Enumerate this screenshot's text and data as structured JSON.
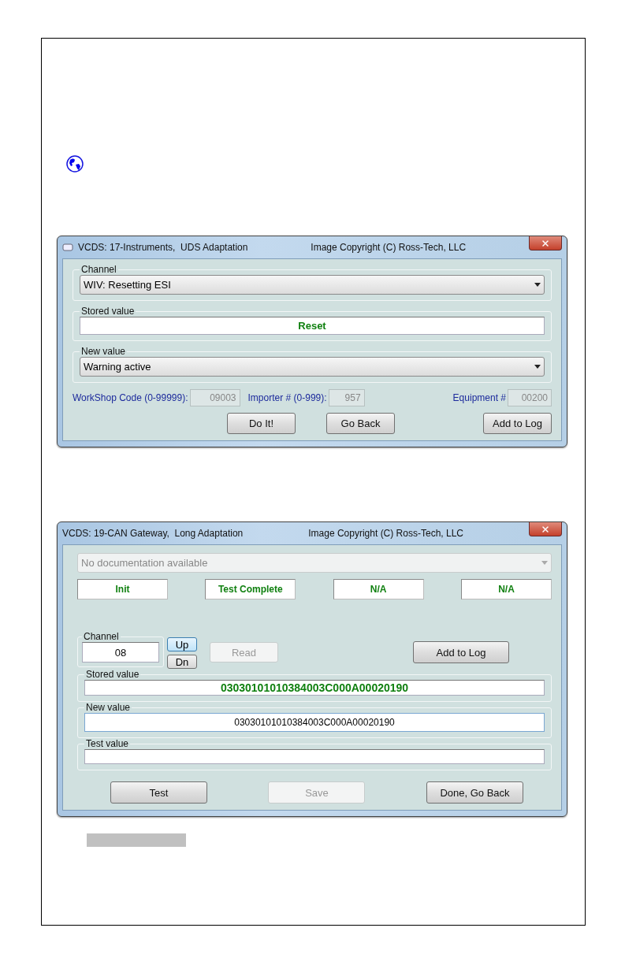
{
  "adaptation_window": {
    "title": "VCDS: 17-Instruments,  UDS Adaptation",
    "copyright": "Image Copyright (C) Ross-Tech, LLC",
    "channel": {
      "label": "Channel",
      "value": "WIV: Resetting ESI"
    },
    "stored_value": {
      "label": "Stored value",
      "value": "Reset"
    },
    "new_value": {
      "label": "New value",
      "value": "Warning active"
    },
    "codes": [
      {
        "label": "WorkShop Code (0-99999):",
        "value": "09003"
      },
      {
        "label": "Importer # (0-999):",
        "value": "957"
      },
      {
        "label": "Equipment #",
        "value": "00200"
      }
    ],
    "buttons": [
      {
        "label": "Do It!",
        "disabled": false
      },
      {
        "label": "Go Back",
        "disabled": false
      },
      {
        "label": "Add to Log",
        "disabled": false
      }
    ]
  },
  "long_adaptation_window": {
    "title": "VCDS: 19-CAN Gateway,  Long Adaptation",
    "copyright": "Image Copyright (C) Ross-Tech, LLC",
    "documentation": {
      "value": "No documentation available",
      "disabled": true
    },
    "status": [
      "Init",
      "Test Complete",
      "N/A",
      "N/A"
    ],
    "channel": {
      "label": "Channel",
      "value": "08"
    },
    "steppers": [
      {
        "label": "Up",
        "highlighted": true
      },
      {
        "label": "Dn",
        "highlighted": false
      }
    ],
    "read_button": {
      "label": "Read",
      "disabled": true
    },
    "log_button": {
      "label": "Add to Log",
      "disabled": false
    },
    "stored_value": {
      "label": "Stored value",
      "value": "03030101010384003C000A00020190"
    },
    "new_value": {
      "label": "New value",
      "value": "03030101010384003C000A00020190"
    },
    "test_value": {
      "label": "Test value"
    },
    "buttons": [
      {
        "label": "Test",
        "disabled": false
      },
      {
        "label": "Save",
        "disabled": true
      },
      {
        "label": "Done, Go Back",
        "disabled": false
      }
    ]
  }
}
